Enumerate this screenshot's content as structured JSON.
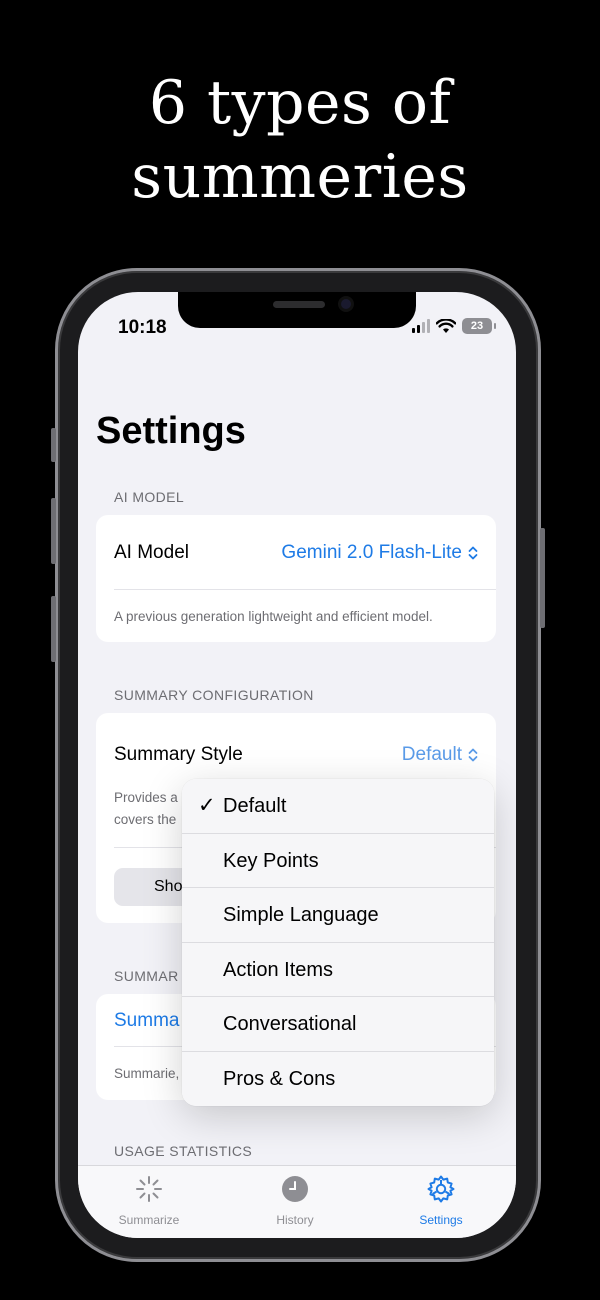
{
  "headline": {
    "line1": "6 types of",
    "line2": "summeries"
  },
  "status_bar": {
    "time": "10:18",
    "battery": "23"
  },
  "page_title": "Settings",
  "ai_model_section": {
    "header": "AI MODEL",
    "label": "AI Model",
    "value": "Gemini 2.0 Flash-Lite",
    "description": "A previous generation lightweight and efficient model."
  },
  "summary_config_section": {
    "header": "SUMMARY CONFIGURATION",
    "label": "Summary Style",
    "value": "Default",
    "description_line1": "Provides a",
    "description_line2": "covers the",
    "button_label": "Sho"
  },
  "summary_section": {
    "header": "SUMMAR",
    "link": "Summa",
    "footnote": "Summarie,"
  },
  "usage_section": {
    "header": "USAGE STATISTICS"
  },
  "style_menu": {
    "selected": "Default",
    "items": [
      "Default",
      "Key Points",
      "Simple Language",
      "Action Items",
      "Conversational",
      "Pros & Cons"
    ]
  },
  "tabbar": {
    "tabs": [
      {
        "label": "Summarize",
        "icon": "sparkle-burst-icon",
        "active": false
      },
      {
        "label": "History",
        "icon": "clock-icon",
        "active": false
      },
      {
        "label": "Settings",
        "icon": "gear-icon",
        "active": true
      }
    ]
  },
  "colors": {
    "accent": "#1e7be6",
    "background": "#000000",
    "screen_bg": "#f2f2f7"
  }
}
